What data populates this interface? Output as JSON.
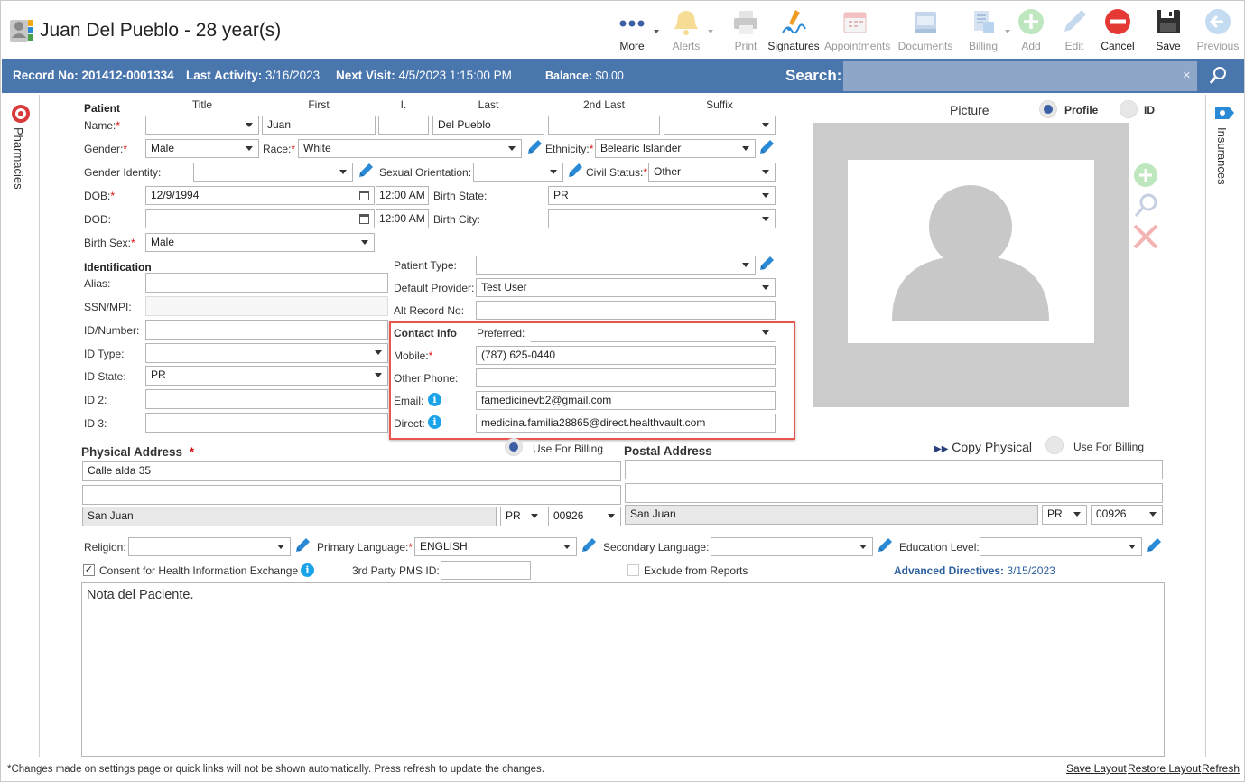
{
  "header": {
    "title": "Juan Del Pueblo - 28 year(s)"
  },
  "toolbar": [
    {
      "id": "more",
      "label": "More",
      "enabled": true
    },
    {
      "id": "alerts",
      "label": "Alerts",
      "enabled": false
    },
    {
      "id": "print",
      "label": "Print",
      "enabled": false
    },
    {
      "id": "signatures",
      "label": "Signatures",
      "enabled": true
    },
    {
      "id": "appointments",
      "label": "Appointments",
      "enabled": false
    },
    {
      "id": "documents",
      "label": "Documents",
      "enabled": false
    },
    {
      "id": "billing",
      "label": "Billing",
      "enabled": false
    },
    {
      "id": "add",
      "label": "Add",
      "enabled": false
    },
    {
      "id": "edit",
      "label": "Edit",
      "enabled": false
    },
    {
      "id": "cancel",
      "label": "Cancel",
      "enabled": true
    },
    {
      "id": "save",
      "label": "Save",
      "enabled": true
    },
    {
      "id": "previous",
      "label": "Previous",
      "enabled": false
    }
  ],
  "infobar": {
    "record_label": "Record No:",
    "record": "201412-0001334",
    "activity_label": "Last Activity:",
    "activity": "3/16/2023",
    "visit_label": "Next Visit:",
    "visit": "4/5/2023 1:15:00 PM",
    "balance_label": "Balance:",
    "balance": "$0.00",
    "search_label": "Search:",
    "search_clear": "×"
  },
  "side": {
    "left": "Pharmacies",
    "right": "Insurances"
  },
  "patient": {
    "section": "Patient",
    "col_title": "Title",
    "col_first": "First",
    "col_initial": "I.",
    "col_last": "Last",
    "col_2nd_last": "2nd Last",
    "col_suffix": "Suffix",
    "name_label": "Name:",
    "first": "Juan",
    "last": "Del Pueblo",
    "gender_label": "Gender:",
    "gender": "Male",
    "race_label": "Race:",
    "race": "White",
    "ethnicity_label": "Ethnicity:",
    "ethnicity": "Belearic Islander",
    "gender_identity_label": "Gender Identity:",
    "sexual_orientation_label": "Sexual Orientation:",
    "civil_status_label": "Civil Status:",
    "civil_status": "Other",
    "dob_label": "DOB:",
    "dob": "12/9/1994",
    "dob_time": "12:00 AM",
    "birth_state_label": "Birth State:",
    "birth_state": "PR",
    "dod_label": "DOD:",
    "dod_time": "12:00 AM",
    "birth_city_label": "Birth City:",
    "birth_sex_label": "Birth Sex:",
    "birth_sex": "Male"
  },
  "identification": {
    "section": "Identification",
    "alias_label": "Alias:",
    "ssn_label": "SSN/MPI:",
    "id_number_label": "ID/Number:",
    "id_type_label": "ID Type:",
    "id_state_label": "ID State:",
    "id_state": "PR",
    "id2_label": "ID 2:",
    "id3_label": "ID 3:",
    "patient_type_label": "Patient Type:",
    "default_provider_label": "Default Provider:",
    "default_provider": "Test User",
    "alt_record_label": "Alt Record No:"
  },
  "contact": {
    "section": "Contact Info",
    "preferred_label": "Preferred:",
    "mobile_label": "Mobile:",
    "mobile": "(787) 625-0440",
    "other_phone_label": "Other Phone:",
    "email_label": "Email:",
    "email": "famedicinevb2@gmail.com",
    "direct_label": "Direct:",
    "direct": "medicina.familia28865@direct.healthvault.com"
  },
  "picture": {
    "label": "Picture",
    "profile": "Profile",
    "id": "ID"
  },
  "physical": {
    "title": "Physical Address",
    "use_billing": "Use For Billing",
    "line1": "Calle alda 35",
    "city": "San Juan",
    "state": "PR",
    "zip": "00926"
  },
  "postal": {
    "title": "Postal Address",
    "copy": "Copy Physical",
    "use_billing": "Use For Billing",
    "city": "San Juan",
    "state": "PR",
    "zip": "00926"
  },
  "misc": {
    "religion_label": "Religion:",
    "primary_lang_label": "Primary Language:",
    "primary_lang": "ENGLISH",
    "secondary_lang_label": "Secondary Language:",
    "education_label": "Education Level:",
    "consent": "Consent for Health Information Exchange",
    "pms_label": "3rd Party PMS ID:",
    "exclude": "Exclude from Reports",
    "adv_label": "Advanced Directives:",
    "adv_date": "3/15/2023"
  },
  "notes": "Nota del Paciente.",
  "footer": {
    "note": "*Changes made on settings page or quick links will not be shown automatically. Press refresh to update the changes.",
    "save_layout": "Save Layout",
    "restore_layout": "Restore Layout",
    "refresh": "Refresh"
  },
  "colors": {
    "bar": "#4a76ae",
    "search": "#8ea6c7",
    "highlight": "#e8574f",
    "accent": "#3b5fa5"
  }
}
